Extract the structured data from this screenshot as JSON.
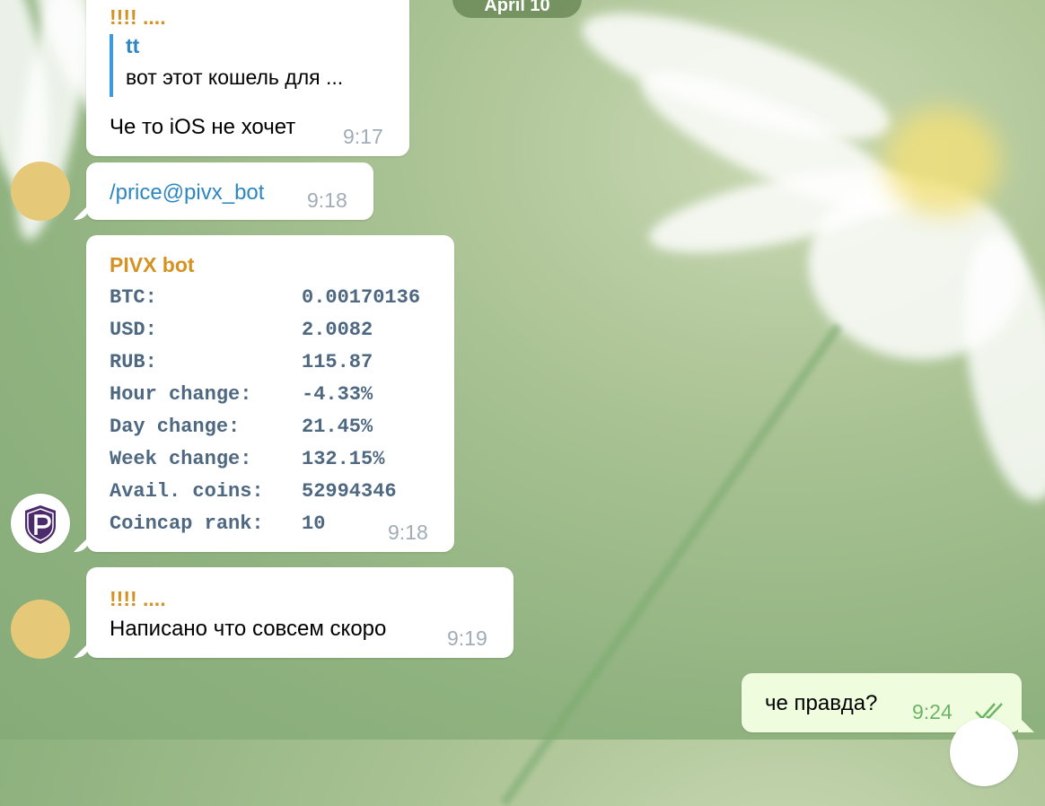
{
  "date_separator": "April 10",
  "messages": [
    {
      "sender": "!!!! ....",
      "reply": {
        "name": "tt",
        "text": "вот этот кошель для ..."
      },
      "text": "Че то iOS не хочет",
      "time": "9:17"
    },
    {
      "text": "/price@pivx_bot",
      "time": "9:18"
    },
    {
      "sender": "PIVX bot",
      "rows": [
        {
          "key": "BTC:",
          "value": "0.00170136"
        },
        {
          "key": "USD:",
          "value": "2.0082"
        },
        {
          "key": "RUB:",
          "value": "115.87"
        },
        {
          "key": "Hour change:",
          "value": "-4.33%"
        },
        {
          "key": "Day change:",
          "value": "21.45%"
        },
        {
          "key": "Week change:",
          "value": "132.15%"
        },
        {
          "key": "Avail. coins:",
          "value": "52994346"
        },
        {
          "key": "Coincap rank:",
          "value": "10"
        }
      ],
      "time": "9:18"
    },
    {
      "sender": "!!!! ....",
      "text": "Написано что совсем скоро",
      "time": "9:19"
    },
    {
      "text": "че правда?",
      "time": "9:24",
      "status_icon": "double-check-icon"
    }
  ],
  "colors": {
    "sender_name": "#d59220",
    "link": "#2d86c0",
    "outgoing_bubble": "#effdde",
    "read_check": "#6db566"
  }
}
